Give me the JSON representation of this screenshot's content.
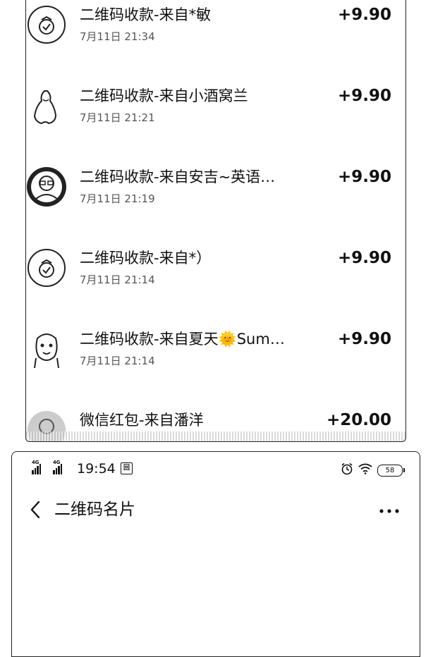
{
  "transactions": [
    {
      "title": "二维码收款-来自*敏",
      "time": "7月11日 21:34",
      "amount": "+9.90",
      "avatar": "money-bag-icon"
    },
    {
      "title": "二维码收款-来自小酒窝兰",
      "time": "7月11日 21:21",
      "amount": "+9.90",
      "avatar": "sketch-figure-avatar"
    },
    {
      "title": "二维码收款-来自安吉~英语…",
      "time": "7月11日 21:19",
      "amount": "+9.90",
      "avatar": "portrait-avatar"
    },
    {
      "title": "二维码收款-来自*）",
      "time": "7月11日 21:14",
      "amount": "+9.90",
      "avatar": "money-bag-icon"
    },
    {
      "title": "二维码收款-来自夏天🌞Sum…",
      "time": "7月11日 21:14",
      "amount": "+9.90",
      "avatar": "sketch-face-avatar"
    },
    {
      "title": "微信红包-来自潘洋",
      "time": "",
      "amount": "+20.00",
      "avatar": "red-packet-avatar"
    }
  ],
  "status_bar": {
    "signal1": "4G",
    "signal2": "4G",
    "time": "19:54",
    "notif": "回",
    "battery": "58"
  },
  "nav": {
    "title": "二维码名片"
  },
  "icons": [
    "chevron-left-icon",
    "more-icon",
    "alarm-icon",
    "wifi-icon",
    "battery-icon"
  ]
}
